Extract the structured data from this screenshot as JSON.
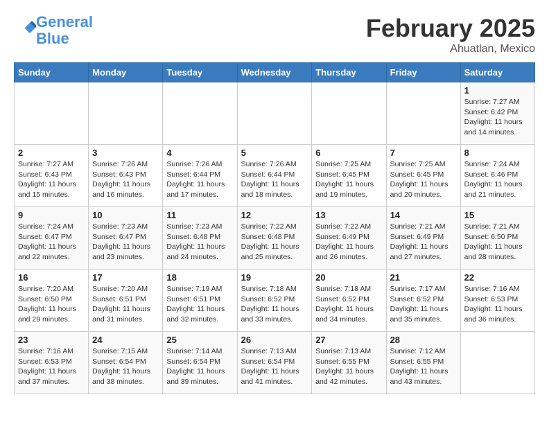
{
  "header": {
    "logo_line1": "General",
    "logo_line2": "Blue",
    "title": "February 2025",
    "subtitle": "Ahuatlan, Mexico"
  },
  "weekdays": [
    "Sunday",
    "Monday",
    "Tuesday",
    "Wednesday",
    "Thursday",
    "Friday",
    "Saturday"
  ],
  "weeks": [
    [
      {
        "day": "",
        "info": ""
      },
      {
        "day": "",
        "info": ""
      },
      {
        "day": "",
        "info": ""
      },
      {
        "day": "",
        "info": ""
      },
      {
        "day": "",
        "info": ""
      },
      {
        "day": "",
        "info": ""
      },
      {
        "day": "1",
        "info": "Sunrise: 7:27 AM\nSunset: 6:42 PM\nDaylight: 11 hours and 14 minutes."
      }
    ],
    [
      {
        "day": "2",
        "info": "Sunrise: 7:27 AM\nSunset: 6:43 PM\nDaylight: 11 hours and 15 minutes."
      },
      {
        "day": "3",
        "info": "Sunrise: 7:26 AM\nSunset: 6:43 PM\nDaylight: 11 hours and 16 minutes."
      },
      {
        "day": "4",
        "info": "Sunrise: 7:26 AM\nSunset: 6:44 PM\nDaylight: 11 hours and 17 minutes."
      },
      {
        "day": "5",
        "info": "Sunrise: 7:26 AM\nSunset: 6:44 PM\nDaylight: 11 hours and 18 minutes."
      },
      {
        "day": "6",
        "info": "Sunrise: 7:25 AM\nSunset: 6:45 PM\nDaylight: 11 hours and 19 minutes."
      },
      {
        "day": "7",
        "info": "Sunrise: 7:25 AM\nSunset: 6:45 PM\nDaylight: 11 hours and 20 minutes."
      },
      {
        "day": "8",
        "info": "Sunrise: 7:24 AM\nSunset: 6:46 PM\nDaylight: 11 hours and 21 minutes."
      }
    ],
    [
      {
        "day": "9",
        "info": "Sunrise: 7:24 AM\nSunset: 6:47 PM\nDaylight: 11 hours and 22 minutes."
      },
      {
        "day": "10",
        "info": "Sunrise: 7:23 AM\nSunset: 6:47 PM\nDaylight: 11 hours and 23 minutes."
      },
      {
        "day": "11",
        "info": "Sunrise: 7:23 AM\nSunset: 6:48 PM\nDaylight: 11 hours and 24 minutes."
      },
      {
        "day": "12",
        "info": "Sunrise: 7:22 AM\nSunset: 6:48 PM\nDaylight: 11 hours and 25 minutes."
      },
      {
        "day": "13",
        "info": "Sunrise: 7:22 AM\nSunset: 6:49 PM\nDaylight: 11 hours and 26 minutes."
      },
      {
        "day": "14",
        "info": "Sunrise: 7:21 AM\nSunset: 6:49 PM\nDaylight: 11 hours and 27 minutes."
      },
      {
        "day": "15",
        "info": "Sunrise: 7:21 AM\nSunset: 6:50 PM\nDaylight: 11 hours and 28 minutes."
      }
    ],
    [
      {
        "day": "16",
        "info": "Sunrise: 7:20 AM\nSunset: 6:50 PM\nDaylight: 11 hours and 29 minutes."
      },
      {
        "day": "17",
        "info": "Sunrise: 7:20 AM\nSunset: 6:51 PM\nDaylight: 11 hours and 31 minutes."
      },
      {
        "day": "18",
        "info": "Sunrise: 7:19 AM\nSunset: 6:51 PM\nDaylight: 11 hours and 32 minutes."
      },
      {
        "day": "19",
        "info": "Sunrise: 7:18 AM\nSunset: 6:52 PM\nDaylight: 11 hours and 33 minutes."
      },
      {
        "day": "20",
        "info": "Sunrise: 7:18 AM\nSunset: 6:52 PM\nDaylight: 11 hours and 34 minutes."
      },
      {
        "day": "21",
        "info": "Sunrise: 7:17 AM\nSunset: 6:52 PM\nDaylight: 11 hours and 35 minutes."
      },
      {
        "day": "22",
        "info": "Sunrise: 7:16 AM\nSunset: 6:53 PM\nDaylight: 11 hours and 36 minutes."
      }
    ],
    [
      {
        "day": "23",
        "info": "Sunrise: 7:16 AM\nSunset: 6:53 PM\nDaylight: 11 hours and 37 minutes."
      },
      {
        "day": "24",
        "info": "Sunrise: 7:15 AM\nSunset: 6:54 PM\nDaylight: 11 hours and 38 minutes."
      },
      {
        "day": "25",
        "info": "Sunrise: 7:14 AM\nSunset: 6:54 PM\nDaylight: 11 hours and 39 minutes."
      },
      {
        "day": "26",
        "info": "Sunrise: 7:13 AM\nSunset: 6:54 PM\nDaylight: 11 hours and 41 minutes."
      },
      {
        "day": "27",
        "info": "Sunrise: 7:13 AM\nSunset: 6:55 PM\nDaylight: 11 hours and 42 minutes."
      },
      {
        "day": "28",
        "info": "Sunrise: 7:12 AM\nSunset: 6:55 PM\nDaylight: 11 hours and 43 minutes."
      },
      {
        "day": "",
        "info": ""
      }
    ]
  ]
}
